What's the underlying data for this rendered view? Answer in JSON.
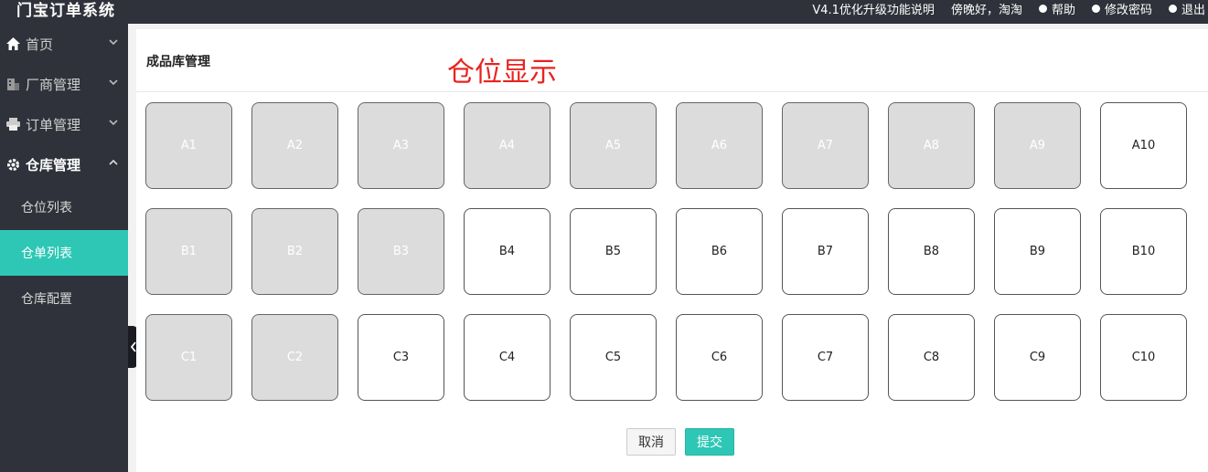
{
  "header": {
    "logo": "门宝订单系统",
    "upgrade_note": "V4.1优化升级功能说明",
    "greeting": "傍晚好，淘淘",
    "help_label": "帮助",
    "password_label": "修改密码",
    "logout_label": "退出"
  },
  "sidebar": {
    "groups": [
      {
        "label": "首页",
        "icon": "home-icon"
      },
      {
        "label": "厂商管理",
        "icon": "building-icon"
      },
      {
        "label": "订单管理",
        "icon": "print-icon"
      },
      {
        "label": "仓库管理",
        "icon": "gear-icon"
      }
    ],
    "sub_items": [
      {
        "label": "仓位列表"
      },
      {
        "label": "仓单列表"
      },
      {
        "label": "仓库配置"
      }
    ]
  },
  "panel": {
    "title": "成品库管理",
    "annotation": "仓位显示"
  },
  "slots": [
    {
      "label": "A1",
      "occupied": true
    },
    {
      "label": "A2",
      "occupied": true
    },
    {
      "label": "A3",
      "occupied": true
    },
    {
      "label": "A4",
      "occupied": true
    },
    {
      "label": "A5",
      "occupied": true
    },
    {
      "label": "A6",
      "occupied": true
    },
    {
      "label": "A7",
      "occupied": true
    },
    {
      "label": "A8",
      "occupied": true
    },
    {
      "label": "A9",
      "occupied": true
    },
    {
      "label": "A10",
      "occupied": false
    },
    {
      "label": "B1",
      "occupied": true
    },
    {
      "label": "B2",
      "occupied": true
    },
    {
      "label": "B3",
      "occupied": true
    },
    {
      "label": "B4",
      "occupied": false
    },
    {
      "label": "B5",
      "occupied": false
    },
    {
      "label": "B6",
      "occupied": false
    },
    {
      "label": "B7",
      "occupied": false
    },
    {
      "label": "B8",
      "occupied": false
    },
    {
      "label": "B9",
      "occupied": false
    },
    {
      "label": "B10",
      "occupied": false
    },
    {
      "label": "C1",
      "occupied": true
    },
    {
      "label": "C2",
      "occupied": true
    },
    {
      "label": "C3",
      "occupied": false
    },
    {
      "label": "C4",
      "occupied": false
    },
    {
      "label": "C5",
      "occupied": false
    },
    {
      "label": "C6",
      "occupied": false
    },
    {
      "label": "C7",
      "occupied": false
    },
    {
      "label": "C8",
      "occupied": false
    },
    {
      "label": "C9",
      "occupied": false
    },
    {
      "label": "C10",
      "occupied": false
    }
  ],
  "actions": {
    "cancel_label": "取消",
    "submit_label": "提交"
  },
  "colors": {
    "accent": "#2ec7b5",
    "sidebar_bg": "#2f323a",
    "occupied_slot": "#dcdcdc",
    "annotation": "#e8231f"
  }
}
